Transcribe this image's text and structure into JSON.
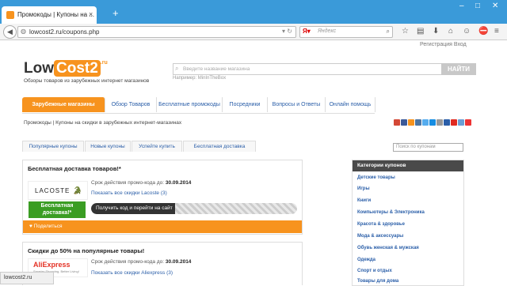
{
  "browser": {
    "tab_title": "Промокоды | Купоны на ...",
    "new_tab": "+",
    "url": "lowcost2.ru/coupons.php",
    "search_engine_placeholder": "Яндекс",
    "window_controls": [
      "–",
      "□",
      "✕"
    ]
  },
  "header": {
    "auth": "Регистрация  Вход",
    "logo_low": "Low",
    "logo_cost2": "Cost2",
    "logo_ru": ".ru",
    "tagline": "Обзоры товаров из зарубежных интернет магазинов",
    "search_placeholder": "Введите название магазина",
    "search_example": "Например: MinInTheBox",
    "search_button": "НАЙТИ"
  },
  "main_nav": [
    {
      "label": "Зарубежные магазины",
      "active": true
    },
    {
      "label": "Обзор Товаров",
      "active": false
    },
    {
      "label": "Бесплатные промокоды",
      "active": false
    },
    {
      "label": "Посредники",
      "active": false
    },
    {
      "label": "Вопросы и Ответы",
      "active": false
    },
    {
      "label": "Онлайн помощь",
      "active": false
    }
  ],
  "breadcrumb": "Промокоды | Купоны на скидки в зарубежных интернет-магазинах",
  "sub_tabs": [
    "Популярные купоны",
    "Новые купоны",
    "Успейте купить",
    "Бесплатная доставка"
  ],
  "coupon_search_placeholder": "Поиск по купонам",
  "coupons": [
    {
      "title": "Бесплатная доставка товаров!*",
      "logo": "LACOSTE",
      "expiry_label": "Срок действия промо-кода до:",
      "expiry_date": "30.09.2014",
      "show_all": "Показать все скидки Lacoste (3)",
      "badge_line1": "Бесплатная",
      "badge_line2": "доставка!*",
      "get_code": "Получить код и перейти на сайт",
      "share": "Поделиться"
    },
    {
      "title": "Скидки до 50% на популярные товары!",
      "logo": "AliExpress",
      "logo_tagline": "Smarter Shopping, Better Living!",
      "expiry_label": "Срок действия промо-кода до:",
      "expiry_date": "30.09.2014",
      "show_all": "Показать все скидки Aliexpress (3)"
    }
  ],
  "sidebar": {
    "header": "Категории купонов",
    "categories": [
      "Детские товары",
      "Игры",
      "Книги",
      "Компьютеры & Электроника",
      "Красота & здоровье",
      "Мода & аксессуары",
      "Обувь женская & мужская",
      "Одежда",
      "Спорт и отдых",
      "Товары для дома"
    ]
  },
  "status_bar": "lowcost2.ru",
  "colors": {
    "accent": "#f7931e",
    "link": "#2a5ea8",
    "green": "#3a9d23",
    "tabbar": "#3a9ad9"
  }
}
